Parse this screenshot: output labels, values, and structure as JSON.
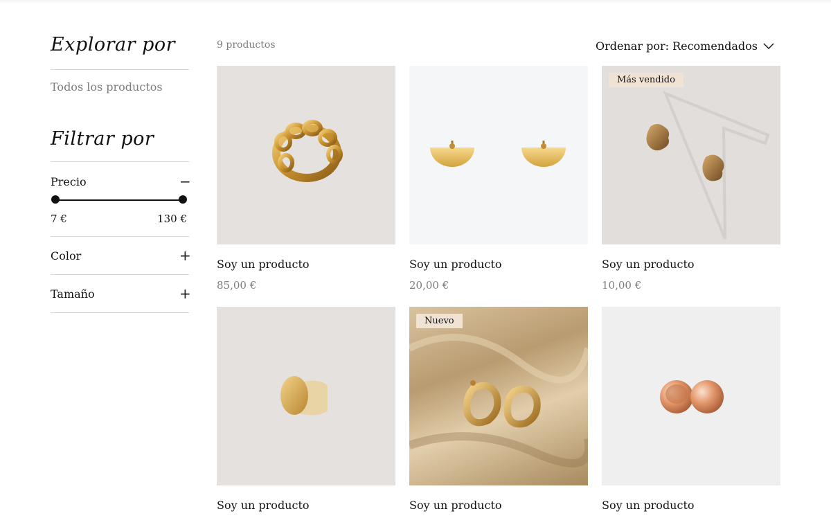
{
  "sidebar": {
    "explore_title": "Explorar por",
    "all_products": "Todos los productos",
    "filter_title": "Filtrar por",
    "filters": {
      "price": {
        "label": "Precio",
        "min": "7 €",
        "max": "130 €",
        "range_min_fraction": 0,
        "range_max_fraction": 1
      },
      "color": {
        "label": "Color"
      },
      "size": {
        "label": "Tamaño"
      }
    }
  },
  "toolbar": {
    "count": "9 productos",
    "sort_label": "Ordenar por: Recomendados"
  },
  "products": [
    {
      "name": "Soy un producto",
      "price": "85,00 €",
      "badge": "",
      "image": "gold-chain-ring"
    },
    {
      "name": "Soy un producto",
      "price": "20,00 €",
      "badge": "",
      "image": "gold-half-moon-earrings"
    },
    {
      "name": "Soy un producto",
      "price": "10,00 €",
      "badge": "Más vendido",
      "image": "gold-wavy-stud-earrings"
    },
    {
      "name": "Soy un producto",
      "price": "",
      "badge": "",
      "image": "gold-disc-ring"
    },
    {
      "name": "Soy un producto",
      "price": "",
      "badge": "Nuevo",
      "image": "gold-twisted-hoop-earrings-on-silk"
    },
    {
      "name": "Soy un producto",
      "price": "",
      "badge": "",
      "image": "rose-gold-ball-earrings"
    }
  ],
  "colors": {
    "badge_bg": "#f0e3d3",
    "muted_text": "#7d7d7d",
    "gold": "#d9a441",
    "image_bg_warm": "#e5e1df",
    "image_bg_cool": "#f5f6f8"
  }
}
